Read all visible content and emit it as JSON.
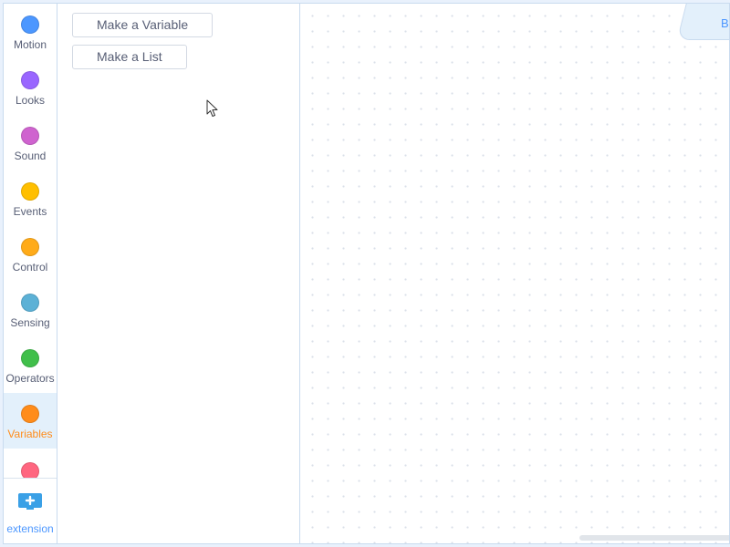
{
  "categories": [
    {
      "label": "Motion",
      "color": "#4c97ff",
      "selected": false
    },
    {
      "label": "Looks",
      "color": "#9966ff",
      "selected": false
    },
    {
      "label": "Sound",
      "color": "#cf63cf",
      "selected": false
    },
    {
      "label": "Events",
      "color": "#ffbf00",
      "selected": false
    },
    {
      "label": "Control",
      "color": "#ffab19",
      "selected": false
    },
    {
      "label": "Sensing",
      "color": "#5cb1d6",
      "selected": false
    },
    {
      "label": "Operators",
      "color": "#40bf4a",
      "selected": false
    },
    {
      "label": "Variables",
      "color": "#ff8c1a",
      "selected": true
    }
  ],
  "partial_category": {
    "color": "#ff6680"
  },
  "extension": {
    "label": "extension",
    "icon": "add-extension-icon",
    "color": "#3aa0e6"
  },
  "flyout": {
    "make_variable": "Make a Variable",
    "make_list": "Make a List"
  },
  "workspace": {
    "tab_text": "B"
  }
}
